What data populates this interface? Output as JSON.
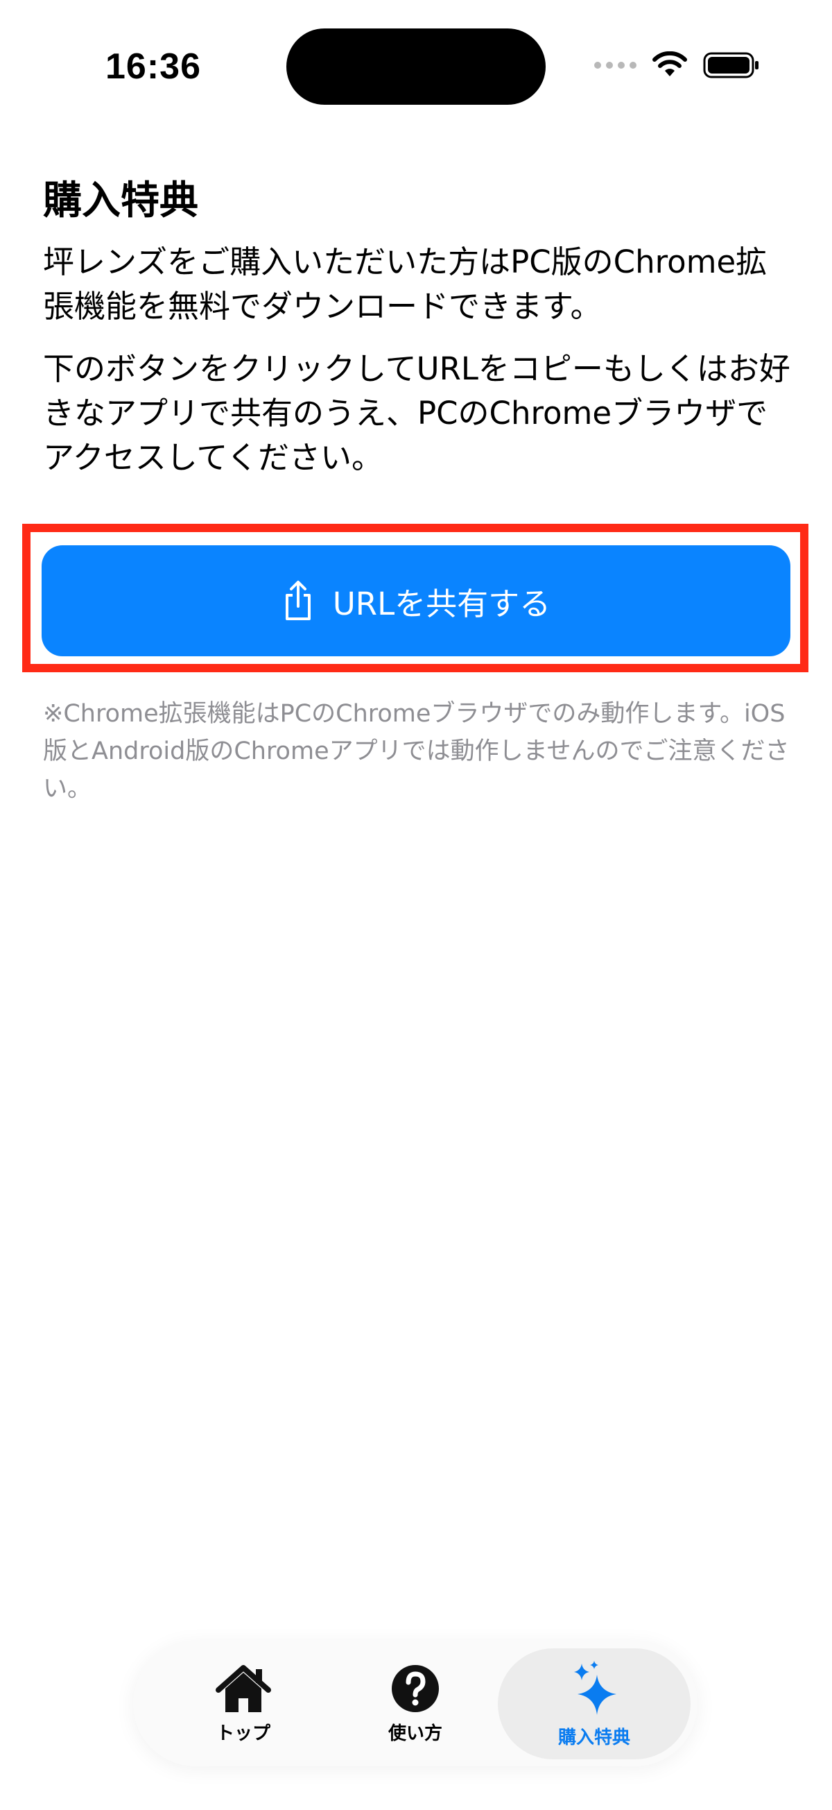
{
  "status_bar": {
    "time": "16:36"
  },
  "page": {
    "title": "購入特典",
    "paragraphs": [
      "坪レンズをご購入いただいた方はPC版のChrome拡張機能を無料でダウンロードできます。",
      "下のボタンをクリックしてURLをコピーもしくはお好きなアプリで共有のうえ、PCのChromeブラウザでアクセスしてください。"
    ],
    "share_button_label": "URLを共有する",
    "note": "※Chrome拡張機能はPCのChromeブラウザでのみ動作します。iOS版とAndroid版のChromeアプリでは動作しませんのでご注意ください。"
  },
  "tab_bar": {
    "items": [
      {
        "label": "トップ",
        "icon": "house-icon",
        "selected": false
      },
      {
        "label": "使い方",
        "icon": "question-circle-icon",
        "selected": false
      },
      {
        "label": "購入特典",
        "icon": "sparkles-icon",
        "selected": true
      }
    ]
  },
  "colors": {
    "accent": "#0a84ff",
    "highlight_frame": "#ff2a16",
    "note_text": "#8e8e93",
    "selected_tab_label": "#0a7cf0"
  },
  "icons": {
    "status": [
      "signal-dots-icon",
      "wifi-icon",
      "battery-icon"
    ],
    "share": "share-icon"
  }
}
